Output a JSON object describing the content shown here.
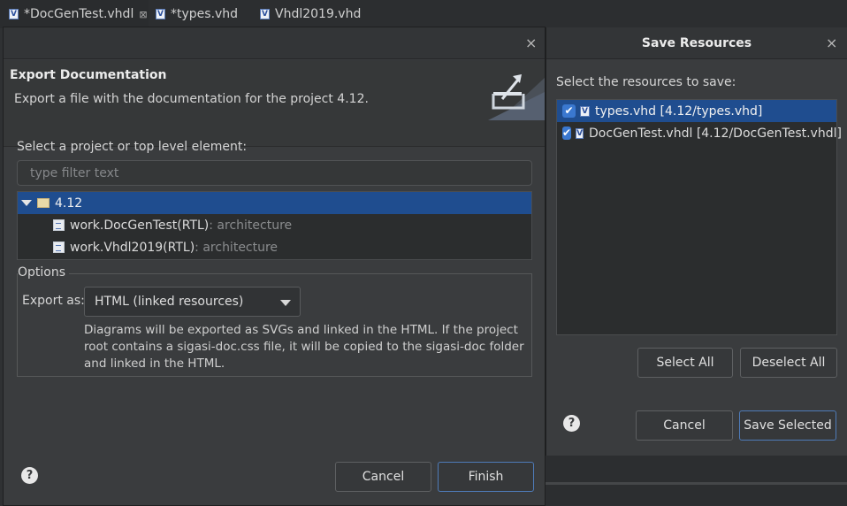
{
  "tabs": [
    {
      "label": "*DocGenTest.vhdl",
      "icon": "vhdl-file-icon"
    },
    {
      "label": "*types.vhd",
      "icon": "vhdl-file-icon"
    },
    {
      "label": "Vhdl2019.vhd",
      "icon": "vhdl-file-icon"
    }
  ],
  "export": {
    "title": "Export Documentation",
    "description": "Export a file with the documentation for the project 4.12.",
    "select_label": "Select a project or top level element:",
    "filter_placeholder": "type filter text",
    "tree": [
      {
        "label": "4.12",
        "type": ""
      },
      {
        "label": "work.DocGenTest(RTL)",
        "type": " : architecture"
      },
      {
        "label": "work.Vhdl2019(RTL)",
        "type": " : architecture"
      }
    ],
    "options_label": "Options",
    "export_as_label": "Export as:",
    "export_as_value": "HTML (linked resources)",
    "help_text": "Diagrams will be exported as SVGs and linked in the HTML. If the project root contains a sigasi-doc.css file, it will be copied to the sigasi-doc folder and linked in the HTML.",
    "cancel": "Cancel",
    "finish": "Finish",
    "help_icon": "?"
  },
  "save": {
    "title": "Save Resources",
    "prompt": "Select the resources to save:",
    "resources": [
      {
        "label": "types.vhd  [4.12/types.vhd]",
        "checked": true
      },
      {
        "label": "DocGenTest.vhdl  [4.12/DocGenTest.vhdl]",
        "checked": true
      }
    ],
    "select_all": "Select All",
    "deselect_all": "Deselect All",
    "cancel": "Cancel",
    "save_selected": "Save Selected",
    "help_icon": "?"
  },
  "colors": {
    "selection": "#1f4d8f",
    "dialog_bg": "#3a3c3e",
    "default_button_border": "#4e7bb8",
    "checkbox": "#3a78d0"
  }
}
